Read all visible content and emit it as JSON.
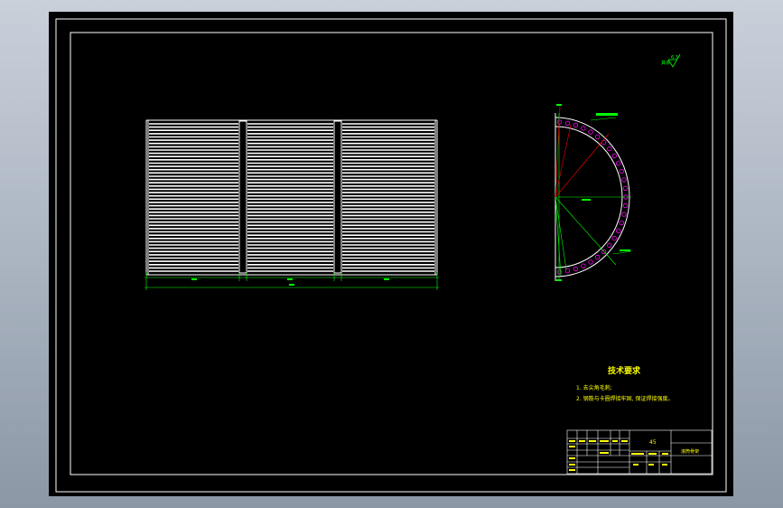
{
  "colors": {
    "frame": "#ffffff",
    "drawing": "#ffffff",
    "dimension": "#00ff00",
    "centerline": "#ff0000",
    "hole": "#ff00ff",
    "note_text": "#ffff00",
    "title_block": "#ffffff"
  },
  "technical_requirements": {
    "heading": "技术要求",
    "items": [
      "1. 去尖角毛刺;",
      "2. 钢筋与卡圈焊接牢固, 保证焊接强度。"
    ]
  },
  "roughness_symbol": {
    "prefix": "其余",
    "value": "6.3"
  },
  "title_block": {
    "material": "45",
    "part_name": "滚筒骨架"
  }
}
